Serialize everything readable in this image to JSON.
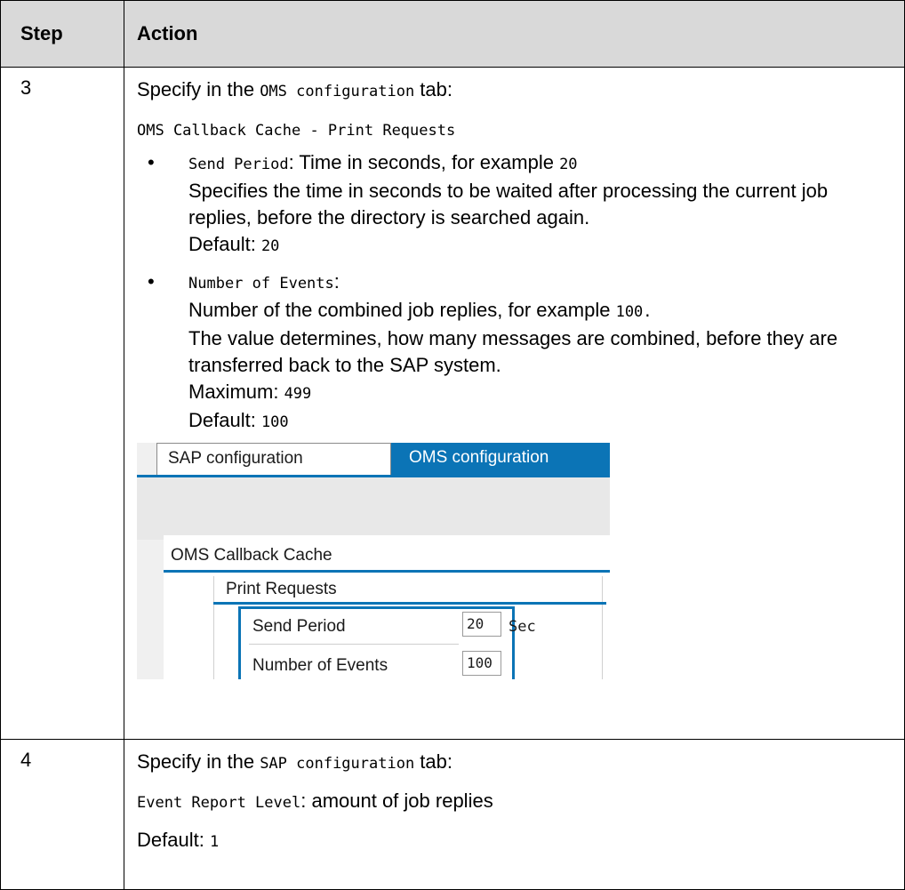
{
  "table": {
    "header": {
      "step": "Step",
      "action": "Action"
    },
    "rows": [
      {
        "step": "3",
        "intro_prefix": "Specify in the ",
        "intro_code": "OMS configuration",
        "intro_suffix": " tab:",
        "path_code": "OMS Callback Cache - Print Requests",
        "bullets": [
          {
            "bullet": "•",
            "code": "Send Period",
            "text1_after_code": ": Time in seconds, for example ",
            "example_code": "20",
            "desc": "Specifies the time in seconds to be waited after processing the current job replies, before the directory is searched again.",
            "default_label": "Default: ",
            "default_code": "20"
          },
          {
            "bullet": "•",
            "code": "Number of Events",
            "text1_after_code": ":",
            "desc_prefix": "Number of the combined job replies, for example ",
            "example_code": "100.",
            "desc": "The value determines, how many messages are combined, before they are transferred back to the SAP system.",
            "max_label": "Maximum: ",
            "max_code": "499",
            "default_label": "Default: ",
            "default_code": "100"
          }
        ],
        "screenshot": {
          "tabs": [
            "SAP configuration",
            "OMS configuration"
          ],
          "active_tab": "OMS configuration",
          "group1": "OMS Callback Cache",
          "group2": "Print Requests",
          "fields": [
            {
              "label": "Send Period",
              "value": "20",
              "unit": "Sec"
            },
            {
              "label": "Number of Events",
              "value": "100"
            }
          ],
          "accent": "#0b74b6"
        }
      },
      {
        "step": "4",
        "intro_prefix": "Specify in the ",
        "intro_code": "SAP configuration",
        "intro_suffix": " tab:",
        "line2_code": "Event Report Level",
        "line2_text": ": amount of job replies",
        "default_label": "Default: ",
        "default_code": "1"
      }
    ]
  }
}
